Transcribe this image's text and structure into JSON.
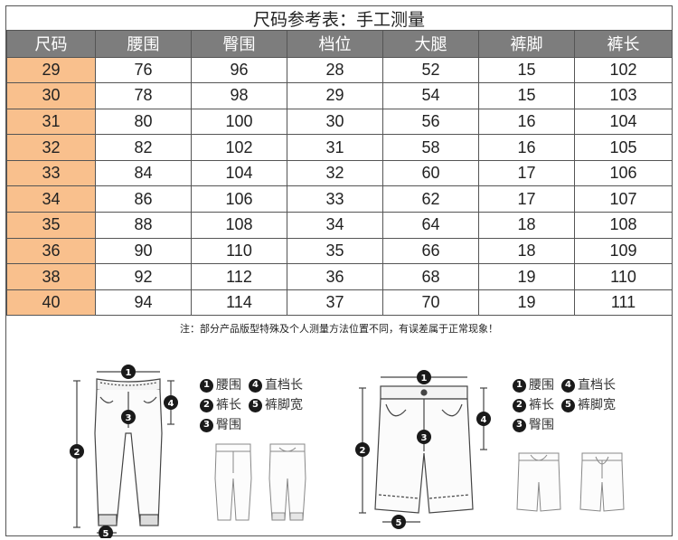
{
  "title": "尺码参考表：手工测量",
  "table": {
    "headers": [
      "尺码",
      "腰围",
      "臀围",
      "档位",
      "大腿",
      "裤脚",
      "裤长"
    ],
    "rows": [
      [
        "29",
        "76",
        "96",
        "28",
        "52",
        "15",
        "102"
      ],
      [
        "30",
        "78",
        "98",
        "29",
        "54",
        "15",
        "103"
      ],
      [
        "31",
        "80",
        "100",
        "30",
        "56",
        "16",
        "104"
      ],
      [
        "32",
        "82",
        "102",
        "31",
        "58",
        "16",
        "105"
      ],
      [
        "33",
        "84",
        "104",
        "32",
        "60",
        "17",
        "106"
      ],
      [
        "34",
        "86",
        "106",
        "33",
        "62",
        "17",
        "107"
      ],
      [
        "35",
        "88",
        "108",
        "34",
        "64",
        "18",
        "108"
      ],
      [
        "36",
        "90",
        "110",
        "35",
        "66",
        "18",
        "109"
      ],
      [
        "38",
        "92",
        "112",
        "36",
        "68",
        "19",
        "110"
      ],
      [
        "40",
        "94",
        "114",
        "37",
        "70",
        "19",
        "111"
      ]
    ]
  },
  "note": "注：部分产品版型特殊及个人测量方法位置不同，有误差属于正常现象！",
  "legend_left": {
    "items": [
      {
        "num": "1",
        "label": "腰围"
      },
      {
        "num": "4",
        "label": "直档长"
      },
      {
        "num": "2",
        "label": "裤长"
      },
      {
        "num": "5",
        "label": "裤脚宽"
      },
      {
        "num": "3",
        "label": "臀围"
      }
    ]
  },
  "legend_right": {
    "items": [
      {
        "num": "1",
        "label": "腰围"
      },
      {
        "num": "4",
        "label": "直档长"
      },
      {
        "num": "2",
        "label": "裤长"
      },
      {
        "num": "5",
        "label": "裤脚宽"
      },
      {
        "num": "3",
        "label": "臀围"
      }
    ]
  },
  "markers": [
    "1",
    "2",
    "3",
    "4",
    "5"
  ],
  "colors": {
    "header_bg": "#7d7d7d",
    "size_cell_bg": "#f9c08d",
    "marker": "#1a1a1a"
  }
}
